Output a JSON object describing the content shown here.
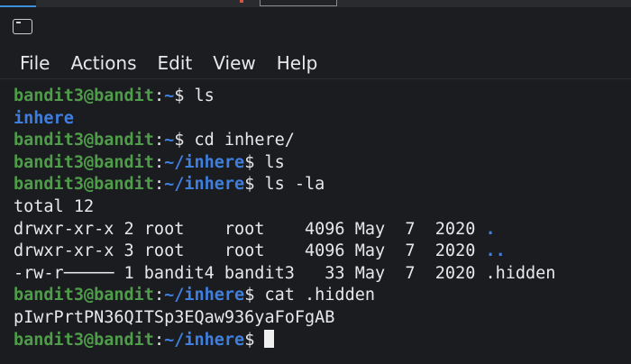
{
  "menubar": {
    "items": [
      "File",
      "Actions",
      "Edit",
      "View",
      "Help"
    ]
  },
  "terminal": {
    "user": "bandit3@bandit",
    "colon": ":",
    "lines": [
      {
        "kind": "prompt",
        "path": "~",
        "cmd": " ls"
      },
      {
        "kind": "dir",
        "text": "inhere"
      },
      {
        "kind": "prompt",
        "path": "~",
        "cmd": " cd inhere/"
      },
      {
        "kind": "prompt",
        "path": "~/inhere",
        "cmd": " ls"
      },
      {
        "kind": "prompt",
        "path": "~/inhere",
        "cmd": " ls -la"
      },
      {
        "kind": "text",
        "text": "total 12"
      },
      {
        "kind": "ls",
        "text": "drwxr-xr-x 2 root    root    4096 May  7  2020 ",
        "name": "."
      },
      {
        "kind": "ls",
        "text": "drwxr-xr-x 3 root    root    4096 May  7  2020 ",
        "name": ".."
      },
      {
        "kind": "text",
        "text": "-rw-r───── 1 bandit4 bandit3   33 May  7  2020 .hidden"
      },
      {
        "kind": "prompt",
        "path": "~/inhere",
        "cmd": " cat .hidden"
      },
      {
        "kind": "text",
        "text": "pIwrPrtPN36QITSp3EQaw936yaFoFgAB"
      },
      {
        "kind": "prompt",
        "path": "~/inhere",
        "cmd": " "
      }
    ]
  },
  "colors": {
    "user": "#4f9c4a",
    "path": "#3f7fe0",
    "text": "#e8e8ea",
    "background": "#1b1c1f"
  }
}
